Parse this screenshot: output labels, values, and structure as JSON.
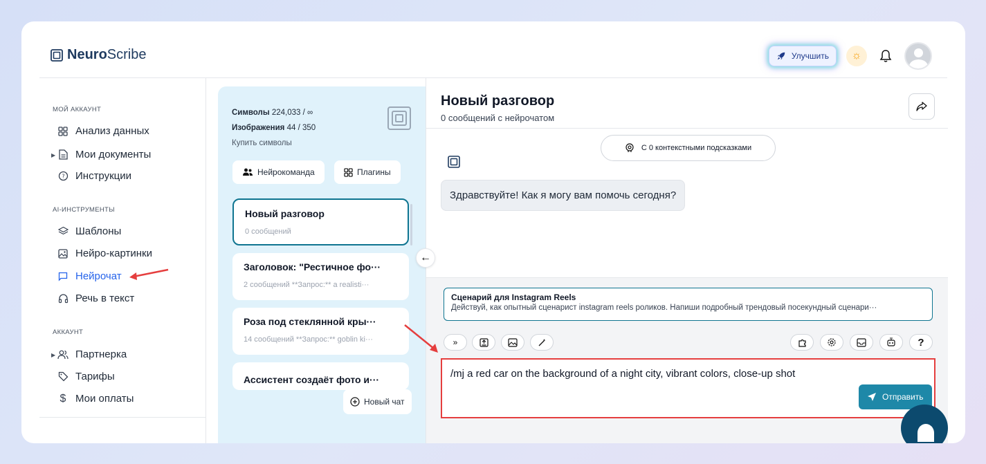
{
  "header": {
    "logo_bold": "Neuro",
    "logo_rest": "Scribe",
    "upgrade_label": "Улучшить"
  },
  "sidebar": {
    "section_account": "МОЙ АККАУНТ",
    "item_analytics": "Анализ данных",
    "item_documents": "Мои документы",
    "item_instructions": "Инструкции",
    "section_ai_tools": "AI-ИНСТРУМЕНТЫ",
    "item_templates": "Шаблоны",
    "item_images": "Нейро-картинки",
    "item_chat": "Нейрочат",
    "item_speech": "Речь в текст",
    "section_acc": "АККАУНТ",
    "item_partner": "Партнерка",
    "item_tariffs": "Тарифы",
    "item_payments": "Мои оплаты"
  },
  "chatlist": {
    "symbols_label": "Символы",
    "symbols_value": "224,033 / ∞",
    "images_label": "Изображения",
    "images_value": "44 / 350",
    "buy_link": "Купить символы",
    "team_button": "Нейрокоманда",
    "plugins_button": "Плагины",
    "items": [
      {
        "title": "Новый разговор",
        "sub": "0 сообщений"
      },
      {
        "title": "Заголовок: \"Рестичное фо···",
        "sub": "2 сообщений   **Запрос:** a realisti···"
      },
      {
        "title": "Роза под стеклянной кры···",
        "sub": "14 сообщений  **Запрос:** goblin ki···"
      },
      {
        "title": "Ассистент создаёт фото и···",
        "sub": ""
      }
    ],
    "new_chat": "Новый чат"
  },
  "main": {
    "title": "Новый разговор",
    "subtitle": "0 сообщений с нейрочатом",
    "context_pill": "С 0 контекстными подсказками",
    "bot_message": "Здравствуйте! Как я могу вам помочь сегодня?",
    "prompt_title": "Сценарий для Instagram Reels",
    "prompt_desc": "Действуй, как опытный сценарист instagram reels роликов. Напиши подробный трендовый посекундный сценари···",
    "input_value": "/mj a red car on the background of a night city,  vibrant colors, close-up shot",
    "send_label": "Отправить",
    "help_label": "?"
  },
  "colors": {
    "accent": "#0e7490",
    "active_nav": "#2563eb",
    "annotation": "#e53e3e",
    "chatlist_bg": "#e0f2fb"
  }
}
